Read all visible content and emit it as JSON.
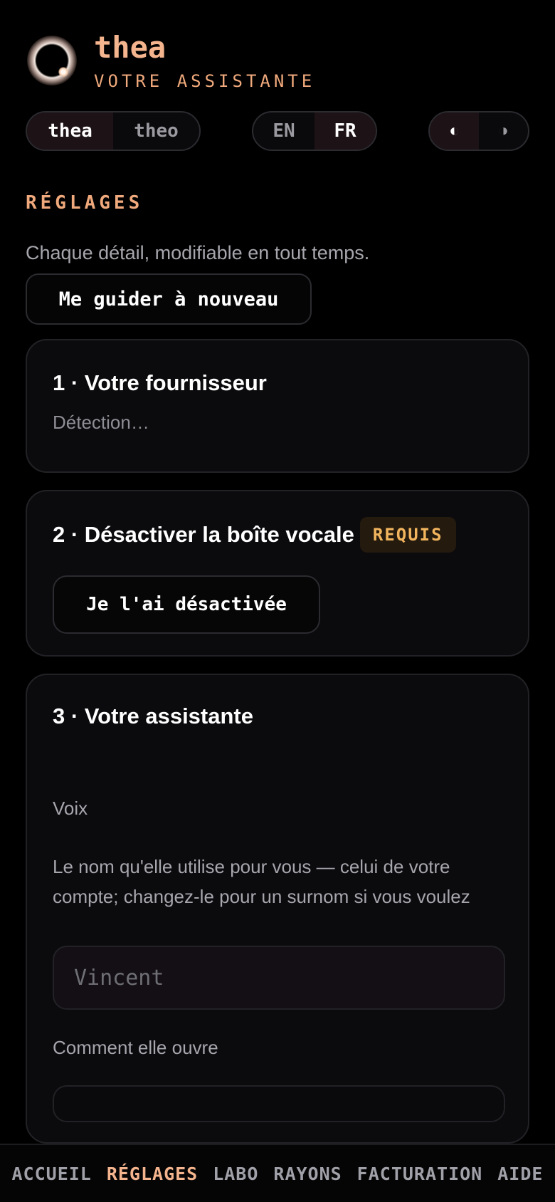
{
  "header": {
    "brand": "thea",
    "subtitle": "VOTRE ASSISTANTE"
  },
  "persona_toggle": {
    "options": [
      "thea",
      "theo"
    ],
    "selected": "thea"
  },
  "language_toggle": {
    "options": [
      "EN",
      "FR"
    ],
    "selected": "FR"
  },
  "theme_toggle": {
    "options": [
      "◐",
      "◑"
    ],
    "selected": "◐"
  },
  "settings": {
    "title": "RÉGLAGES",
    "description": "Chaque détail, modifiable en tout temps.",
    "guide_button": "Me guider à nouveau"
  },
  "cards": [
    {
      "title": "1 · Votre fournisseur",
      "status": "Détection…"
    },
    {
      "title": "2 · Désactiver la boîte vocale",
      "badge": "REQUIS",
      "button": "Je l'ai désactivée"
    },
    {
      "title": "3 · Votre assistante",
      "voice_label": "Voix",
      "name_label": "Le nom qu'elle utilise pour vous — celui de votre compte; changez-le pour un surnom si vous voulez",
      "name_placeholder": "Vincent",
      "opening_label": "Comment elle ouvre"
    }
  ],
  "bottom_nav": {
    "items": [
      "ACCUEIL",
      "RÉGLAGES",
      "LABO",
      "RAYONS",
      "FACTURATION",
      "AIDE"
    ],
    "active": "RÉGLAGES"
  },
  "colors": {
    "accent": "#f4b48d",
    "badge_text": "#f2b55e",
    "background": "#000000",
    "card_background": "#0b0a0d"
  }
}
